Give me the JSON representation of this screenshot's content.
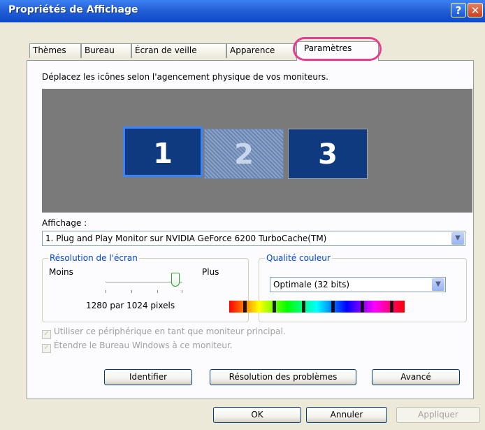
{
  "window": {
    "title": "Propriétés de Affichage",
    "help_icon": "?",
    "close_icon": "✕"
  },
  "tabs": [
    {
      "label": "Thèmes"
    },
    {
      "label": "Bureau"
    },
    {
      "label": "Écran de veille"
    },
    {
      "label": "Apparence"
    },
    {
      "label": "Paramètres",
      "active": true
    }
  ],
  "settings": {
    "instruction": "Déplacez les icônes selon l'agencement physique de vos moniteurs.",
    "monitors": [
      "1",
      "2",
      "3"
    ],
    "display_label": "Affichage :",
    "display_value": "1. Plug and Play Monitor sur NVIDIA GeForce 6200 TurboCache(TM)",
    "resolution": {
      "legend": "Résolution de l'écran",
      "less": "Moins",
      "more": "Plus",
      "value": "1280 par 1024 pixels",
      "slider_fraction": 0.9
    },
    "quality": {
      "legend": "Qualité couleur",
      "value": "Optimale (32 bits)"
    },
    "checkboxes": [
      {
        "label": "Utiliser ce périphérique en tant que moniteur principal.",
        "checked": true
      },
      {
        "label": "Étendre le Bureau Windows à ce moniteur.",
        "checked": true
      }
    ],
    "buttons": {
      "identify": "Identifier",
      "troubleshoot": "Résolution des problèmes",
      "advanced": "Avancé"
    }
  },
  "footer": {
    "ok": "OK",
    "cancel": "Annuler",
    "apply": "Appliquer"
  },
  "colors": {
    "accent": "#0b49c9",
    "highlight": "#e63d8f"
  }
}
